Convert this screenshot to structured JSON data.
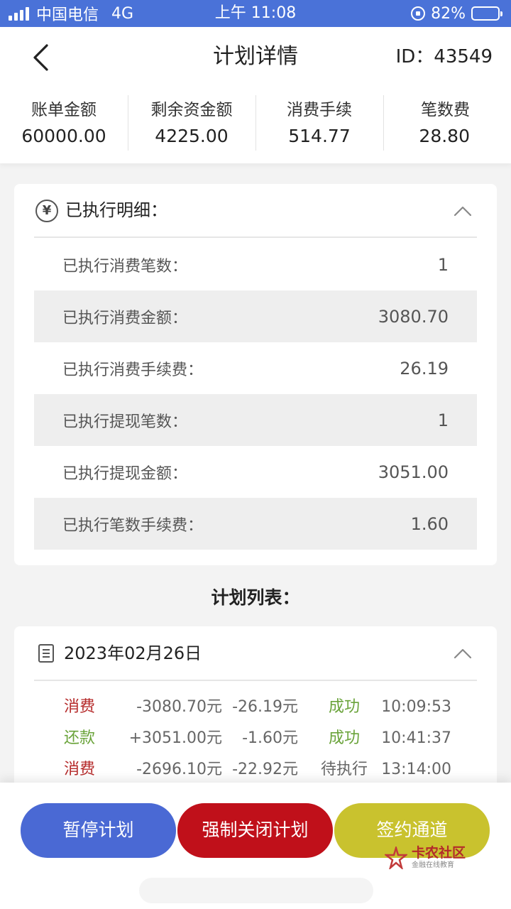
{
  "status_bar": {
    "carrier": "中国电信",
    "network": "4G",
    "time": "上午 11:08",
    "battery": "82%",
    "battery_level": 0.82
  },
  "header": {
    "title": "计划详情",
    "id_label": "ID：43549",
    "back_icon": "chevron-left-icon"
  },
  "summary": [
    {
      "label": "账单金额",
      "value": "60000.00"
    },
    {
      "label": "剩余资金额",
      "value": "4225.00"
    },
    {
      "label": "消费手续",
      "value": "514.77"
    },
    {
      "label": "笔数费",
      "value": "28.80"
    }
  ],
  "executed": {
    "title": "已执行明细：",
    "icon": "yen-icon",
    "rows": [
      {
        "label": "已执行消费笔数：",
        "value": "1"
      },
      {
        "label": "已执行消费金额：",
        "value": "3080.70"
      },
      {
        "label": "已执行消费手续费：",
        "value": "26.19"
      },
      {
        "label": "已执行提现笔数：",
        "value": "1"
      },
      {
        "label": "已执行提现金额：",
        "value": "3051.00"
      },
      {
        "label": "已执行笔数手续费：",
        "value": "1.60"
      }
    ]
  },
  "plan_list": {
    "heading": "计划列表：",
    "date": "2023年02月26日",
    "rows": [
      {
        "type": "消费",
        "amount": "-3080.70元",
        "fee": "-26.19元",
        "status": "成功",
        "time": "10:09:53"
      },
      {
        "type": "还款",
        "amount": "+3051.00元",
        "fee": "-1.60元",
        "status": "成功",
        "time": "10:41:37"
      },
      {
        "type": "消费",
        "amount": "-2696.10元",
        "fee": "-22.92元",
        "status": "待执行",
        "time": "13:14:00"
      }
    ]
  },
  "actions": {
    "pause": "暂停计划",
    "force_close": "强制关闭计划",
    "sign": "签约通道"
  },
  "watermark": {
    "name": "卡农社区",
    "tagline": "金融在线教育"
  },
  "colors": {
    "status_bar": "#4a72d8",
    "pause_button": "#4a69d4",
    "close_button": "#c0101a",
    "sign_button": "#c9c22e",
    "consume_type": "#b52a2a",
    "repay_type": "#6aa33a",
    "success_status": "#6aa33a"
  }
}
